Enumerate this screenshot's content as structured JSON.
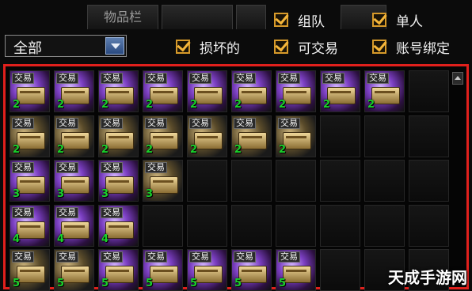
{
  "tabs": [
    "物品栏",
    "",
    "",
    ""
  ],
  "filters": {
    "team": "组队",
    "single": "单人",
    "broken": "损坏的",
    "tradable": "可交易",
    "account_bind": "账号绑定"
  },
  "dropdown": {
    "value": "全部"
  },
  "item_tag": "交易",
  "inventory": {
    "rows": [
      {
        "items": [
          {
            "qty": "2",
            "style": "purple"
          },
          {
            "qty": "2",
            "style": "purple"
          },
          {
            "qty": "2",
            "style": "purple"
          },
          {
            "qty": "2",
            "style": "purple"
          },
          {
            "qty": "2",
            "style": "purple"
          },
          {
            "qty": "2",
            "style": "purple"
          },
          {
            "qty": "2",
            "style": "purple"
          },
          {
            "qty": "2",
            "style": "purple"
          },
          {
            "qty": "2",
            "style": "purple"
          }
        ]
      },
      {
        "items": [
          {
            "qty": "2",
            "style": "gold"
          },
          {
            "qty": "2",
            "style": "gold"
          },
          {
            "qty": "2",
            "style": "gold"
          },
          {
            "qty": "2",
            "style": "gold"
          },
          {
            "qty": "2",
            "style": "gold"
          },
          {
            "qty": "2",
            "style": "gold"
          },
          {
            "qty": "2",
            "style": "gold"
          }
        ]
      },
      {
        "items": [
          {
            "qty": "3",
            "style": "purple"
          },
          {
            "qty": "3",
            "style": "purple"
          },
          {
            "qty": "3",
            "style": "purple"
          },
          {
            "qty": "3",
            "style": "gold"
          }
        ]
      },
      {
        "items": [
          {
            "qty": "4",
            "style": "purple"
          },
          {
            "qty": "4",
            "style": "purple"
          },
          {
            "qty": "4",
            "style": "purple"
          }
        ]
      },
      {
        "items": [
          {
            "qty": "5",
            "style": "gold"
          },
          {
            "qty": "5",
            "style": "gold"
          },
          {
            "qty": "5",
            "style": "purple"
          },
          {
            "qty": "5",
            "style": "purple"
          },
          {
            "qty": "5",
            "style": "purple"
          },
          {
            "qty": "5",
            "style": "purple"
          },
          {
            "qty": "5",
            "style": "purple"
          }
        ]
      }
    ]
  },
  "watermark": "天成手游网",
  "colors": {
    "highlight_border": "#e0201c",
    "qty_text": "#19d12b",
    "checkbox": "#f4b53a"
  }
}
